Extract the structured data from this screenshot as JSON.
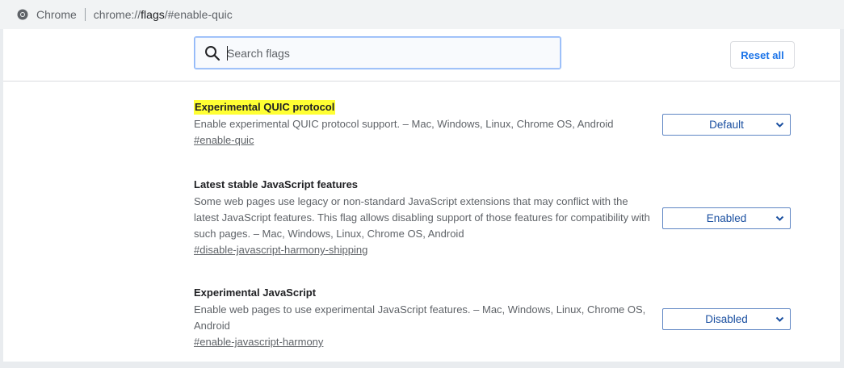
{
  "omnibox": {
    "site_name": "Chrome",
    "url_prefix": "chrome://",
    "url_host": "flags",
    "url_suffix": "/#enable-quic"
  },
  "search": {
    "placeholder": "Search flags",
    "value": ""
  },
  "reset_button": "Reset all",
  "flags": [
    {
      "title": "Experimental QUIC protocol",
      "description": "Enable experimental QUIC protocol support. – Mac, Windows, Linux, Chrome OS, Android",
      "anchor": "#enable-quic",
      "selected": "Default",
      "highlighted": true
    },
    {
      "title": "Latest stable JavaScript features",
      "description": "Some web pages use legacy or non-standard JavaScript extensions that may conflict with the latest JavaScript features. This flag allows disabling support of those features for compatibility with such pages. – Mac, Windows, Linux, Chrome OS, Android",
      "anchor": "#disable-javascript-harmony-shipping",
      "selected": "Enabled",
      "highlighted": false
    },
    {
      "title": "Experimental JavaScript",
      "description": "Enable web pages to use experimental JavaScript features. – Mac, Windows, Linux, Chrome OS, Android",
      "anchor": "#enable-javascript-harmony",
      "selected": "Disabled",
      "highlighted": false
    }
  ],
  "colors": {
    "accent": "#1a73e8",
    "highlight": "#ffff33",
    "select_text": "#1a4fa0"
  }
}
